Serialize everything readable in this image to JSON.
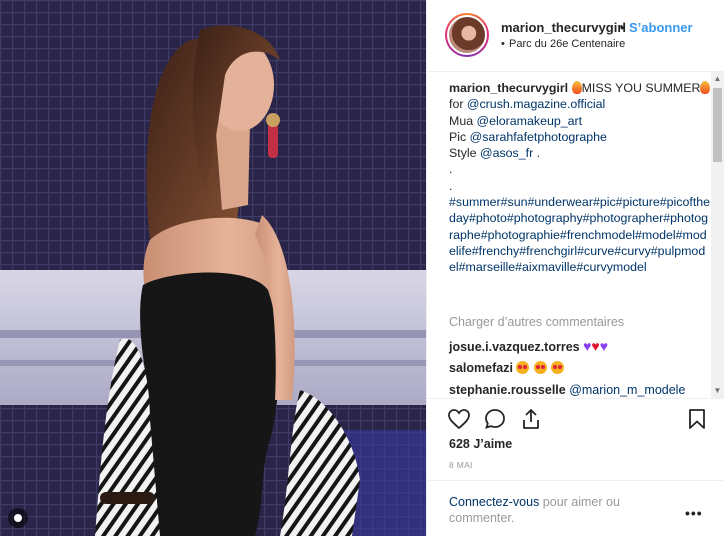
{
  "header": {
    "username": "marion_thecurvygirl",
    "dot": "•",
    "follow_label": "S’abonner",
    "location": "Parc du 26e Centenaire"
  },
  "caption": {
    "username": "marion_thecurvygirl",
    "title": "MISS YOU SUMMER",
    "lines": [
      {
        "prefix": "for ",
        "mention": "@crush.magazine.official"
      },
      {
        "prefix": "Mua ",
        "mention": "@eloramakeup_art"
      },
      {
        "prefix": "Pic ",
        "mention": "@sarahfafetphotographe"
      },
      {
        "prefix": "Style ",
        "mention": "@asos_fr",
        "suffix": " ."
      }
    ],
    "dot1": ".",
    "dot2": ".",
    "hashtags": "#summer#sun#underwear#pic#picture#picoftheday#photo#photography#photographer#photographe#photographie#frenchmodel#model#modelife#frenchy#frenchgirl#curve#curvy#pulpmodel#marseille#aixmaville#curvymodel"
  },
  "load_more": "Charger d’autres commentaires",
  "comments": [
    {
      "user": "josue.i.vazquez.torres",
      "emoji": [
        "purple-heart",
        "red-heart",
        "purple-heart"
      ]
    },
    {
      "user": "salomefazi",
      "emoji": [
        "heart-eyes",
        "heart-eyes",
        "heart-eyes"
      ]
    },
    {
      "user": "stephanie.rousselle",
      "mention": "@marion_m_modele"
    }
  ],
  "likes": "628 J’aime",
  "date": "8 MAI",
  "login": {
    "link": "Connectez-vous",
    "text": " pour aimer ou commenter."
  },
  "menu": "•••",
  "icons": [
    "heart-outline",
    "comment-bubble",
    "share-arrow",
    "bookmark"
  ],
  "colors": {
    "accent": "#3897f0",
    "link": "#003569",
    "muted": "#999999"
  }
}
